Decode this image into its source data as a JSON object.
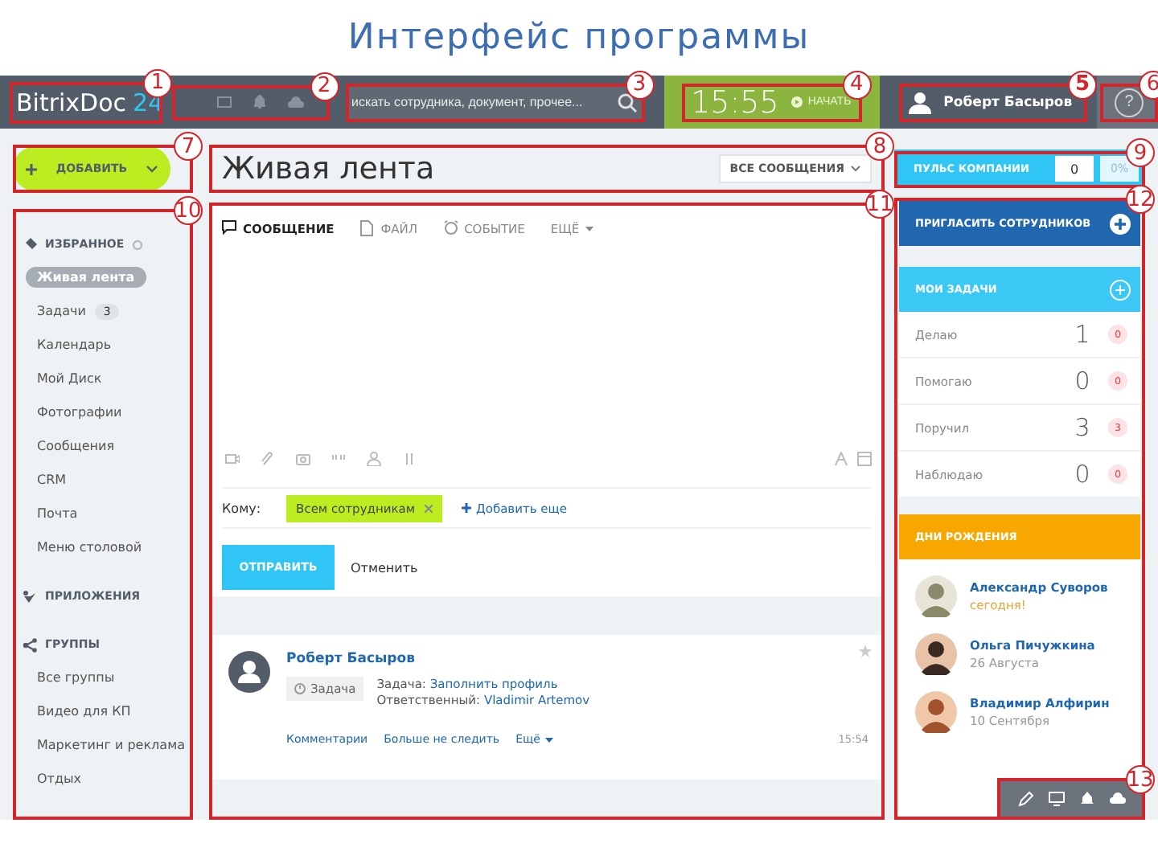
{
  "slide_title": "Интерфейс программы",
  "header": {
    "logo": {
      "name": "BitrixDoc",
      "number": "24",
      "callout": "1"
    },
    "notify": {
      "callout": "2"
    },
    "search": {
      "placeholder": "искать сотрудника, документ, прочее...",
      "callout": "3"
    },
    "clock": {
      "time": "15:55",
      "action": "НАЧАТЬ",
      "callout": "4"
    },
    "user": {
      "name": "Роберт Басыров",
      "callout": "5"
    },
    "help": {
      "label": "?",
      "callout": "6"
    }
  },
  "add_button": {
    "label": "ДОБАВИТЬ",
    "callout": "7"
  },
  "page_title": {
    "title": "Живая лента",
    "filter": "ВСЕ СООБЩЕНИЯ",
    "callout": "8"
  },
  "pulse": {
    "label": "ПУЛЬС КОМПАНИИ",
    "count": "0",
    "percent": "0%",
    "callout": "9"
  },
  "sidebar": {
    "callout": "10",
    "sections": [
      {
        "title": "ИЗБРАННОЕ",
        "kind": "favorites",
        "items": [
          {
            "label": "Живая лента",
            "selected": true
          },
          {
            "label": "Задачи",
            "badge": "3",
            "selected": false
          },
          {
            "label": "Календарь",
            "selected": false
          },
          {
            "label": "Мой Диск",
            "selected": false
          },
          {
            "label": "Фотографии",
            "selected": false
          },
          {
            "label": "Сообщения",
            "selected": false
          },
          {
            "label": "CRM",
            "selected": false
          },
          {
            "label": "Почта",
            "selected": false
          },
          {
            "label": "Меню столовой",
            "selected": false
          }
        ]
      },
      {
        "title": "ПРИЛОЖЕНИЯ",
        "kind": "apps"
      },
      {
        "title": "ГРУППЫ",
        "kind": "groups",
        "items": [
          {
            "label": "Все группы",
            "selected": false
          },
          {
            "label": "Видео для КП",
            "selected": false
          },
          {
            "label": "Маркетинг и реклама",
            "selected": false
          },
          {
            "label": "Отдых",
            "selected": false
          }
        ]
      }
    ]
  },
  "composer": {
    "callout": "11",
    "tabs": [
      {
        "label": "СООБЩЕНИЕ",
        "selected": true
      },
      {
        "label": "ФАЙЛ",
        "selected": false
      },
      {
        "label": "СОБЫТИЕ",
        "selected": false
      },
      {
        "label": "ЕЩЁ",
        "selected": false
      }
    ],
    "to_label": "Кому:",
    "recipient": "Всем сотрудникам",
    "add_more": "Добавить еще",
    "send": "ОТПРАВИТЬ",
    "cancel": "Отменить"
  },
  "post": {
    "author": "Роберт Басыров",
    "tag": "Задача",
    "task_label": "Задача:",
    "task_link": "Заполнить профиль",
    "responsible_label": "Ответственный:",
    "responsible": "Vladimir Artemov",
    "actions": [
      "Комментарии",
      "Больше не следить",
      "Ещё"
    ],
    "time": "15:54"
  },
  "right": {
    "callout": "12"
  },
  "invite": {
    "label": "ПРИГЛАСИТЬ СОТРУДНИКОВ"
  },
  "tasks": {
    "title": "МОИ ЗАДАЧИ",
    "rows": [
      {
        "label": "Делаю",
        "count": "1",
        "badge": "0"
      },
      {
        "label": "Помогаю",
        "count": "0",
        "badge": "0"
      },
      {
        "label": "Поручил",
        "count": "3",
        "badge": "3"
      },
      {
        "label": "Наблюдаю",
        "count": "0",
        "badge": "0"
      }
    ]
  },
  "birthdays": {
    "title": "ДНИ РОЖДЕНИЯ",
    "people": [
      {
        "name": "Александр Суворов",
        "date": "сегодня!",
        "today": true
      },
      {
        "name": "Ольга Пичужкина",
        "date": "26 Августа",
        "today": false
      },
      {
        "name": "Владимир Алфирин",
        "date": "10 Сентября",
        "today": false
      }
    ]
  },
  "toolbar": {
    "callout": "13"
  }
}
